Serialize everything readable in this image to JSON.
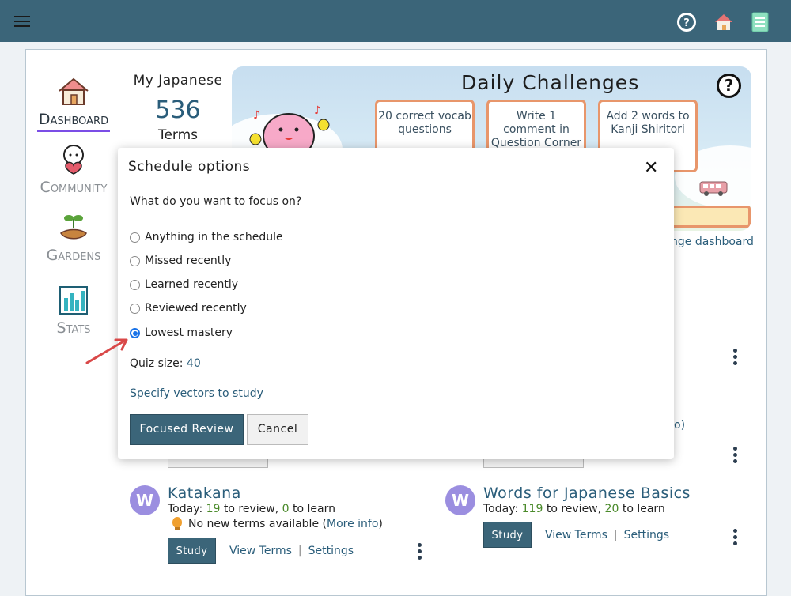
{
  "topbar": {
    "help_icon": "help-circle-icon",
    "home_icon": "home-icon",
    "notebook_icon": "notebook-icon"
  },
  "nav": {
    "items": [
      {
        "label": "Dashboard",
        "icon": "house-icon",
        "active": true
      },
      {
        "label": "Community",
        "icon": "heart-character-icon",
        "active": false
      },
      {
        "label": "Gardens",
        "icon": "sprout-hand-icon",
        "active": false
      },
      {
        "label": "Stats",
        "icon": "bar-chart-icon",
        "active": false
      }
    ]
  },
  "summary": {
    "title": "My Japanese",
    "count": "536",
    "unit": "Terms"
  },
  "challenges": {
    "title": "Daily Challenges",
    "cards": [
      {
        "text": "20 correct vocab questions"
      },
      {
        "text": "Write 1 comment in Question Corner"
      },
      {
        "text": "Add 2 words to Kanji Shiritori"
      }
    ],
    "change_link": "nge dashboard"
  },
  "modal": {
    "title": "Schedule options",
    "question": "What do you want to focus on?",
    "options": [
      {
        "label": "Anything in the schedule",
        "selected": false
      },
      {
        "label": "Missed recently",
        "selected": false
      },
      {
        "label": "Learned recently",
        "selected": false
      },
      {
        "label": "Reviewed recently",
        "selected": false
      },
      {
        "label": "Lowest mastery",
        "selected": true
      }
    ],
    "quiz_size_label": "Quiz size:",
    "quiz_size_value": "40",
    "vectors_link": "Specify vectors to study",
    "primary_button": "Focused Review",
    "cancel_button": "Cancel"
  },
  "partial_text": "o)",
  "decks": [
    {
      "avatar": "W",
      "title": "Katakana",
      "today_prefix": "Today:",
      "review": "19",
      "review_label": "to review,",
      "learn": "0",
      "learn_label": "to learn",
      "notice": "No new terms available (",
      "notice_link": "More info",
      "notice_end": ")",
      "study": "Study",
      "view_terms": "View Terms",
      "separator": "|",
      "settings": "Settings"
    },
    {
      "avatar": "W",
      "title": "Words for Japanese Basics",
      "today_prefix": "Today:",
      "review": "119",
      "review_label": "to review,",
      "learn": "20",
      "learn_label": "to learn",
      "study": "Study",
      "view_terms": "View Terms",
      "separator": "|",
      "settings": "Settings"
    }
  ]
}
